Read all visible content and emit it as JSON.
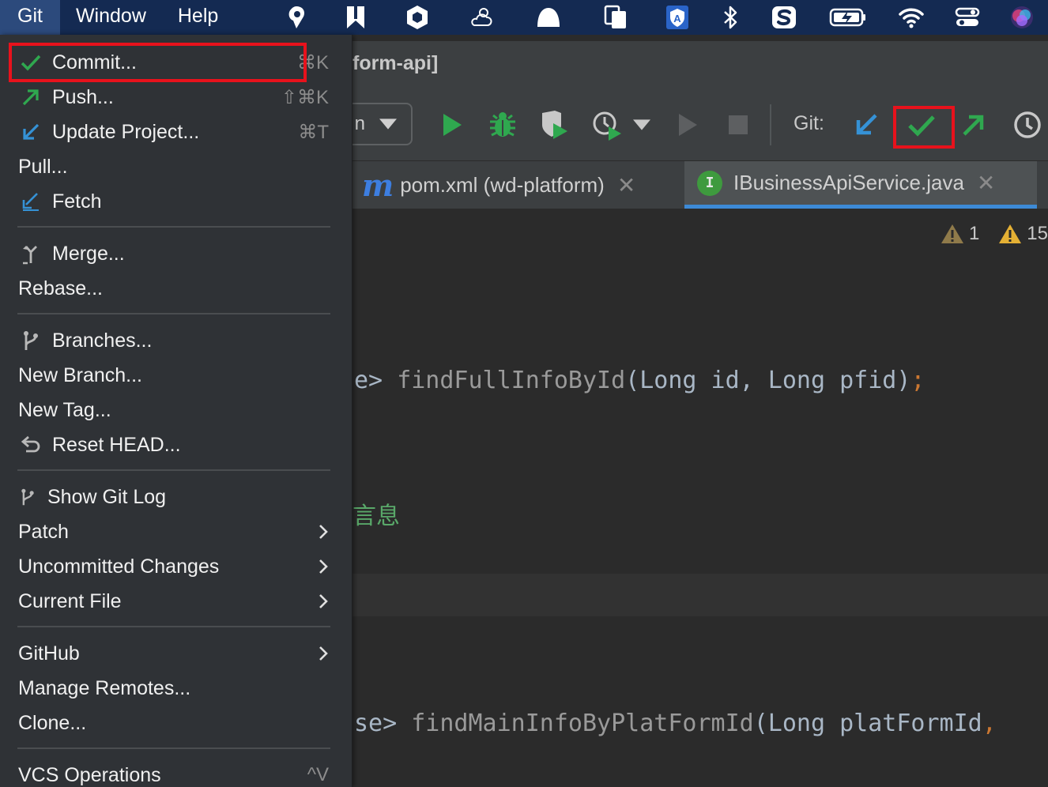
{
  "menubar": {
    "items": [
      "Git",
      "Window",
      "Help"
    ],
    "tray_icons": [
      "pin-icon",
      "bookmark-icon",
      "hexagon-icon",
      "weather-icon",
      "cloud-icon",
      "copy-icon",
      "shield-a-icon",
      "bluetooth-icon",
      "s-app-icon",
      "battery-icon",
      "wifi-icon",
      "control-center-icon",
      "siri-icon"
    ]
  },
  "ide": {
    "title_fragment": "form-api]",
    "run_config_fragment": "n",
    "git_label": "Git:",
    "tabs": [
      {
        "label": "pom.xml (wd-platform)",
        "icon": "maven-icon"
      },
      {
        "label": "IBusinessApiService.java",
        "icon": "interface-icon",
        "active": true
      }
    ],
    "inspections": {
      "weak_warnings": "1",
      "warnings": "15"
    },
    "code": {
      "line1_prefix": "e>",
      "line1_fn": "findFullInfoById",
      "line1_args": "(Long id, Long pfid)",
      "line1_semi": ";",
      "comment_fragment": "言息",
      "line2_prefix": "se>",
      "line2_fn": "findMainInfoByPlatFormId",
      "line2_args": "(Long platFormId",
      "line2_comma": ","
    }
  },
  "git_menu": {
    "commit": {
      "label": "Commit...",
      "shortcut": "⌘K"
    },
    "push": {
      "label": "Push...",
      "shortcut": "⇧⌘K"
    },
    "update": {
      "label": "Update Project...",
      "shortcut": "⌘T"
    },
    "pull": {
      "label": "Pull..."
    },
    "fetch": {
      "label": "Fetch"
    },
    "merge": {
      "label": "Merge..."
    },
    "rebase": {
      "label": "Rebase..."
    },
    "branches": {
      "label": "Branches..."
    },
    "new_branch": {
      "label": "New Branch..."
    },
    "new_tag": {
      "label": "New Tag..."
    },
    "reset_head": {
      "label": "Reset HEAD..."
    },
    "show_git_log": {
      "label": "Show Git Log"
    },
    "patch": {
      "label": "Patch"
    },
    "uncommitted": {
      "label": "Uncommitted Changes"
    },
    "current_file": {
      "label": "Current File"
    },
    "github": {
      "label": "GitHub"
    },
    "manage_remotes": {
      "label": "Manage Remotes..."
    },
    "clone": {
      "label": "Clone..."
    },
    "vcs_operations": {
      "label": "VCS Operations",
      "shortcut": "^V"
    }
  },
  "colors": {
    "menubar_bg": "#142a52",
    "menu_bg": "#2f3236",
    "highlight_red": "#e8121c",
    "git_green": "#2fa84f",
    "git_blue": "#3592d6"
  }
}
